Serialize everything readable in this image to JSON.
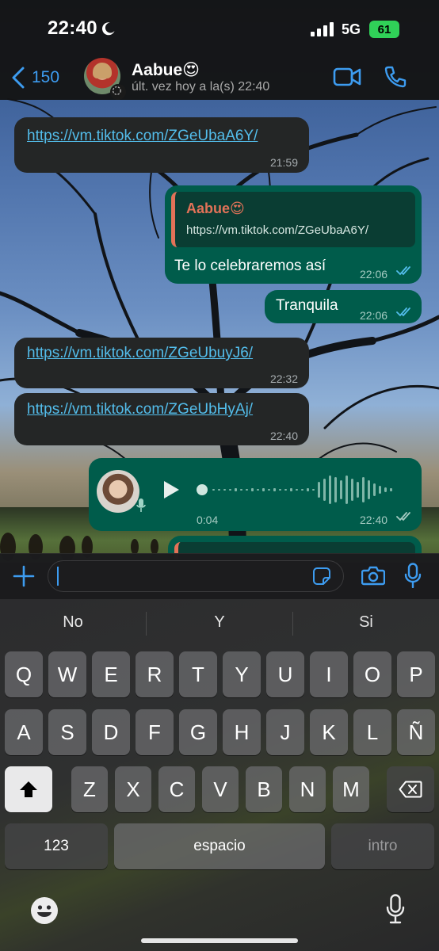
{
  "status_bar": {
    "time": "22:40",
    "network": "5G",
    "battery": "61"
  },
  "header": {
    "back_count": "150",
    "contact_name": "Aabue😍",
    "contact_status": "últ. vez hoy a la(s) 22:40"
  },
  "messages": [
    {
      "direction": "in",
      "text": "https://vm.tiktok.com/ZGeUbaA6Y/",
      "time": "21:59"
    },
    {
      "direction": "out",
      "quote_author": "Aabue😍",
      "quote_text": "https://vm.tiktok.com/ZGeUbaA6Y/",
      "text": "Te lo celebraremos así",
      "time": "22:06",
      "status": "read"
    },
    {
      "direction": "out",
      "text": "Tranquila",
      "time": "22:06",
      "status": "read"
    },
    {
      "direction": "in",
      "text": "https://vm.tiktok.com/ZGeUbuyJ6/",
      "time": "22:32"
    },
    {
      "direction": "in",
      "text": "https://vm.tiktok.com/ZGeUbHyAj/",
      "time": "22:40"
    },
    {
      "direction": "out",
      "type": "voice",
      "duration": "0:04",
      "time": "22:40",
      "status": "delivered"
    }
  ],
  "input": {
    "placeholder": ""
  },
  "keyboard": {
    "suggestions": [
      "No",
      "Y",
      "Si"
    ],
    "row1": [
      "Q",
      "W",
      "E",
      "R",
      "T",
      "Y",
      "U",
      "I",
      "O",
      "P"
    ],
    "row2": [
      "A",
      "S",
      "D",
      "F",
      "G",
      "H",
      "J",
      "K",
      "L",
      "Ñ"
    ],
    "row3": [
      "Z",
      "X",
      "C",
      "V",
      "B",
      "N",
      "M"
    ],
    "numbers_label": "123",
    "space_label": "espacio",
    "return_label": "intro"
  },
  "colors": {
    "accent": "#3d9cf0",
    "outgoing_bubble": "#005c4b",
    "incoming_bubble": "#242626",
    "link": "#53bdeb",
    "read_ticks": "#53bdeb",
    "battery": "#30d158",
    "quote_author": "#e27258"
  },
  "icons": [
    "moon-icon",
    "signal-icon",
    "battery-icon",
    "chevron-left-icon",
    "video-call-icon",
    "phone-icon",
    "play-icon",
    "mic-icon",
    "plus-icon",
    "sticker-icon",
    "camera-icon",
    "shift-icon",
    "backspace-icon",
    "emoji-icon",
    "dictation-icon"
  ]
}
